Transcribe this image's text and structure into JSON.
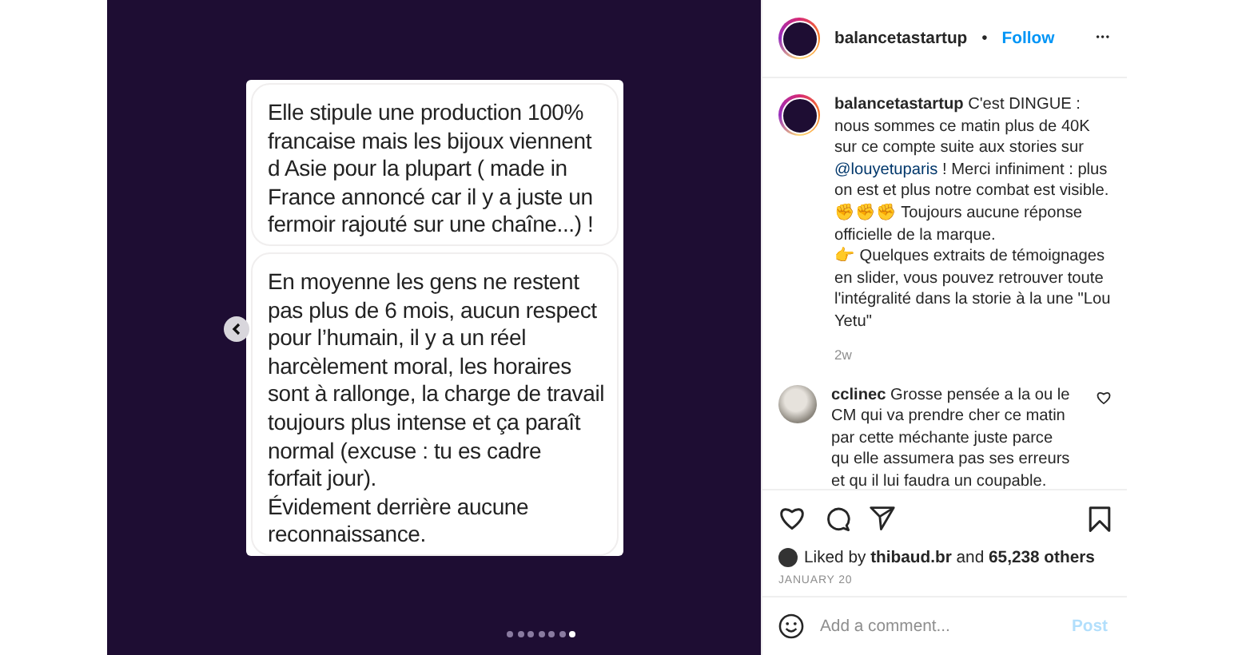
{
  "media": {
    "bubbles": [
      {
        "lines": [
          "Elle stipule une production 100%",
          "francaise mais les bijoux viennent",
          "d Asie pour la plupart ( made in",
          "France annoncé car il y a juste un",
          "fermoir rajouté sur une chaîne...) !"
        ]
      },
      {
        "lines": [
          "En moyenne les gens ne restent",
          "pas plus de 6 mois, aucun respect",
          "pour l’humain, il y a un réel",
          "harcèlement moral, les horaires",
          "sont à rallonge, la charge de travail",
          "toujours plus intense et ça paraît",
          "normal (excuse : tu es cadre",
          "forfait jour).",
          "Évidement derrière aucune",
          "reconnaissance."
        ]
      }
    ],
    "dots": [
      {
        "selected": false
      },
      {
        "selected": false
      },
      {
        "selected": false
      },
      {
        "selected": false
      },
      {
        "selected": false
      },
      {
        "selected": false
      },
      {
        "selected": true
      }
    ]
  },
  "header": {
    "username": "balancetastartup",
    "separator": "•",
    "follow": "Follow",
    "more": "•••"
  },
  "caption": {
    "username": "balancetastartup",
    "parts": [
      "C'est DINGUE : nous sommes ce matin plus de 40K sur ce compte suite aux stories sur ",
      "@louyetuparis",
      " ! Merci infiniment : plus on est et plus notre combat est visible. ✊✊✊ Toujours aucune réponse officielle de la marque.",
      "👉 Quelques extraits de témoignages en slider, vous pouvez retrouver toute l'intégralité dans la storie à la une \"Lou Yetu\""
    ],
    "age": "2w"
  },
  "comments": [
    {
      "username": "cclinec",
      "text": "Grosse pensée a la ou le CM qui va prendre cher ce matin par cette méchante juste parce qu elle assumera pas ses erreurs et qu il lui faudra un coupable.",
      "liked": false
    }
  ],
  "likes": {
    "prefix": "Liked by",
    "user": "thibaud.br",
    "middle": "and",
    "count": "65,238 others"
  },
  "date": "JANUARY 20",
  "comment_box": {
    "placeholder": "Add a comment...",
    "post": "Post"
  }
}
